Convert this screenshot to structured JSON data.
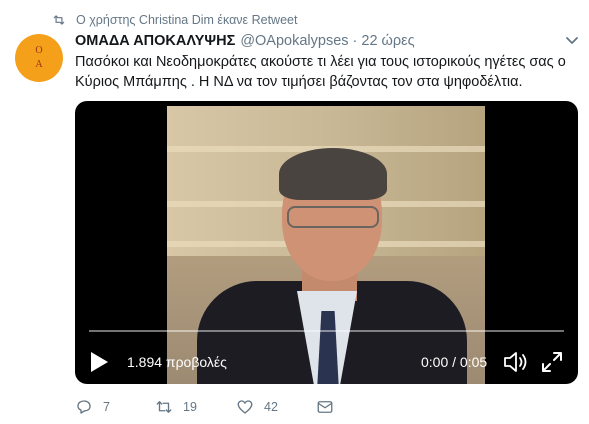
{
  "retweet": {
    "icon": "retweet-icon",
    "text": "Ο χρήστης Christina Dim έκανε Retweet"
  },
  "avatar": {
    "line1": "Ο",
    "line2": "Α",
    "color": "#f5a01a"
  },
  "tweet": {
    "display_name": "ΟΜΑΔΑ ΑΠΟΚΑΛΥΨΗΣ",
    "handle": "@OApokalypses",
    "separator": "·",
    "time": "22 ώρες",
    "text": "Πασόκοι  και Νεοδημοκράτες  ακούστε τι λέει για τους ιστορικούς ηγέτες σας ο Κύριος Μπάμπης . Η ΝΔ να τον τιμήσει βάζοντας τον στα ψηφοδέλτια."
  },
  "video": {
    "views": "1.894 προβολές",
    "timecode": "0:00 / 0:05",
    "progress_percent": 0,
    "icons": [
      "play-icon",
      "volume-icon",
      "fullscreen-icon"
    ]
  },
  "actions": {
    "reply_count": "7",
    "retweet_count": "19",
    "like_count": "42",
    "icons": [
      "reply-icon",
      "retweet-icon",
      "like-icon",
      "message-icon"
    ]
  },
  "colors": {
    "text_secondary": "#657786",
    "text_primary": "#14171a"
  }
}
